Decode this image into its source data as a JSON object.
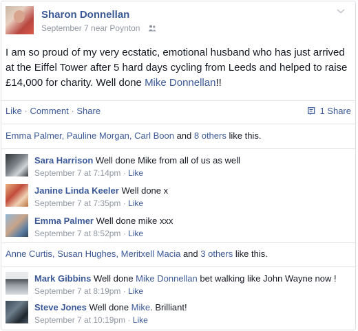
{
  "post": {
    "author": "Sharon Donnellan",
    "meta": "September 7 near Poynton",
    "text_before_link": "I am so proud of my very ecstatic, emotional husband who has just arrived at the Eiffel Tower after 5 hard days cycling from Leeds and helped to raise £14,000 for charity. Well done ",
    "text_link": "Mike Donnellan",
    "text_after_link": "!!"
  },
  "actions": {
    "like": "Like",
    "comment": "Comment",
    "share": "Share",
    "separator": "·",
    "share_count": "1 Share"
  },
  "likes_1": {
    "names": "Emma Palmer, Pauline Morgan, Carl Boon",
    "and": " and ",
    "others": "8 others",
    "suffix": " like this."
  },
  "likes_2": {
    "names": "Anne Curtis, Susan Hughes, Meritxell Macia",
    "and": " and ",
    "others": "3 others",
    "suffix": " like this."
  },
  "comments": [
    {
      "author": "Sara Harrison",
      "text": " Well done Mike from all of us as well",
      "time": "September 7 at 7:14pm",
      "like": "Like"
    },
    {
      "author": "Janine Linda Keeler",
      "text": " Well done x",
      "time": "September 7 at 7:35pm",
      "like": "Like"
    },
    {
      "author": "Emma Palmer",
      "text": " Well done mike xxx",
      "time": "September 7 at 8:52pm",
      "like": "Like"
    },
    {
      "author": "Mark Gibbins",
      "text_before": " Well done ",
      "link": "Mike Donnellan",
      "text_after": " bet walking like John Wayne now !",
      "time": "September 7 at 8:19pm",
      "like": "Like"
    },
    {
      "author": "Steve Jones",
      "text_before": " Well done ",
      "link": "Mike",
      "text_after": ". Brilliant!",
      "time": "September 7 at 10:19pm",
      "like": "Like"
    }
  ],
  "icons": {
    "audience": "people-icon",
    "menu": "chevron-down-icon",
    "share": "share-icon"
  },
  "colors": {
    "link": "#3b5998",
    "meta": "#9197a3",
    "text": "#141823"
  }
}
